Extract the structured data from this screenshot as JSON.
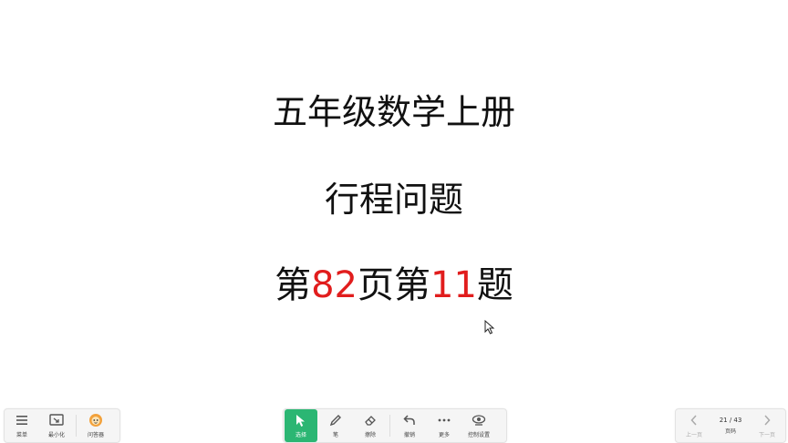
{
  "slide": {
    "line1": "五年级数学上册",
    "line2": "行程问题",
    "line3": {
      "part1": "第",
      "num1": "82",
      "part2": "页第",
      "num2": "11",
      "part3": "题"
    }
  },
  "toolbar": {
    "left": [
      {
        "name": "menu",
        "label": "菜单",
        "icon": "menu-icon"
      },
      {
        "name": "minimize",
        "label": "最小化",
        "icon": "minimize-icon"
      },
      {
        "name": "assistant",
        "label": "问答器",
        "icon": "assistant-icon"
      }
    ],
    "center": [
      {
        "name": "select",
        "label": "选择",
        "icon": "cursor-icon",
        "active": true
      },
      {
        "name": "pen",
        "label": "笔",
        "icon": "pen-icon"
      },
      {
        "name": "eraser",
        "label": "擦除",
        "icon": "eraser-icon"
      },
      {
        "name": "undo",
        "label": "撤销",
        "icon": "undo-icon"
      },
      {
        "name": "more",
        "label": "更多",
        "icon": "more-icon"
      },
      {
        "name": "settings",
        "label": "控制设置",
        "icon": "settings-icon"
      }
    ],
    "right": {
      "prev_label": "上一页",
      "page_indicator": "21 / 43",
      "page_label": "页码",
      "next_label": "下一页"
    }
  },
  "colors": {
    "accent": "#2bb673",
    "highlight": "#e11d1d"
  }
}
